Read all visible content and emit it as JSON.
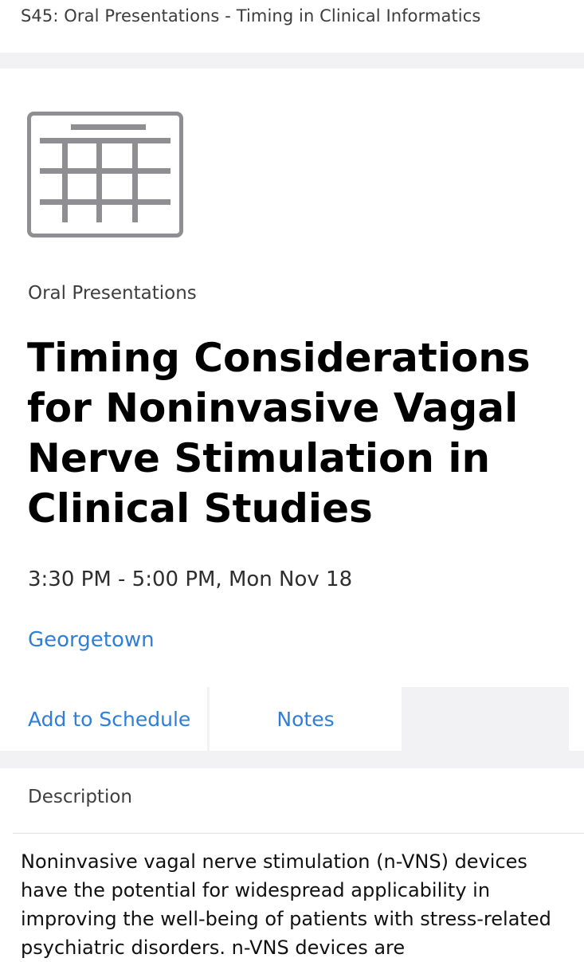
{
  "header": {
    "title": "S45: Oral Presentations - Timing in Clinical Informatics"
  },
  "session": {
    "icon": "calendar-icon",
    "category": "Oral Presentations",
    "title": "Timing Considerations for Noninvasive Vagal Nerve Stimulation in Clinical Studies",
    "time": "3:30 PM - 5:00 PM, Mon Nov 18",
    "location": "Georgetown"
  },
  "actions": {
    "add_to_schedule": "Add to Schedule",
    "notes": "Notes"
  },
  "description": {
    "heading": "Description",
    "body": "Noninvasive vagal nerve stimulation (n-VNS) devices have the potential for widespread applicability in improving the well-being of patients with stress-related psychiatric disorders. n-VNS devices are"
  },
  "colors": {
    "link": "#2f7ed8",
    "band": "#f2f2f4",
    "icon": "#8e8e93"
  }
}
